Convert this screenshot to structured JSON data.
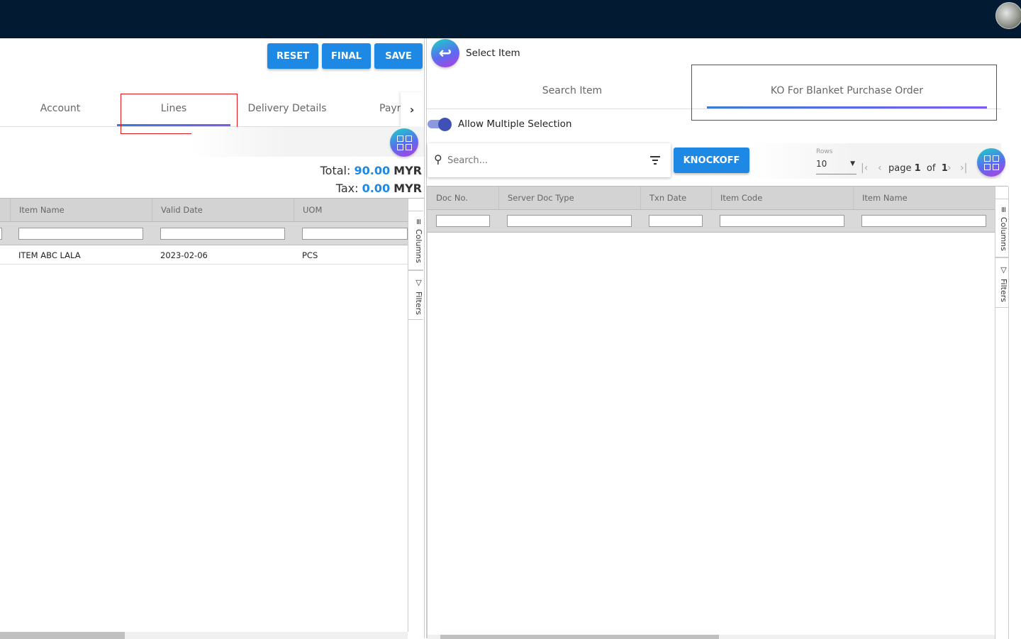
{
  "header": {
    "avatar_label": "user avatar"
  },
  "left": {
    "buttons": {
      "reset": "RESET",
      "final": "FINAL",
      "save": "SAVE"
    },
    "tabs": [
      "Account",
      "Lines",
      "Delivery Details",
      "Payment"
    ],
    "tab_visible_partial": "Payr",
    "active_tab": "Lines",
    "totals": {
      "total_label": "Total:",
      "total_value": "90.00",
      "total_currency": "MYR",
      "tax_label": "Tax:",
      "tax_value": "0.00",
      "tax_currency": "MYR"
    },
    "grid": {
      "columns": [
        "Item Name",
        "Valid Date",
        "UOM"
      ],
      "rows": [
        {
          "item_name": "ITEM ABC LALA",
          "valid_date": "2023-02-06",
          "uom": "PCS"
        }
      ],
      "side_columns": "Columns",
      "side_filters": "Filters"
    }
  },
  "right": {
    "title": "Select Item",
    "tabs": [
      "Search Item",
      "KO For Blanket Purchase Order"
    ],
    "active_tab": "KO For Blanket Purchase Order",
    "toggle": {
      "label": "Allow Multiple Selection",
      "on": true
    },
    "search": {
      "placeholder": "Search...",
      "value": ""
    },
    "knockoff": "KNOCKOFF",
    "pager": {
      "rows_label": "Rows",
      "rows_value": "10",
      "page_label": "page",
      "page": "1",
      "of_label": "of",
      "total_pages": "1"
    },
    "grid": {
      "columns": [
        "Doc No.",
        "Server Doc Type",
        "Txn Date",
        "Item Code",
        "Item Name"
      ],
      "rows": [],
      "side_columns": "Columns",
      "side_filters": "Filters"
    }
  },
  "colors": {
    "topbar": "#021b33",
    "accent": "#1e88e5",
    "highlight_box": "#e0161a"
  }
}
